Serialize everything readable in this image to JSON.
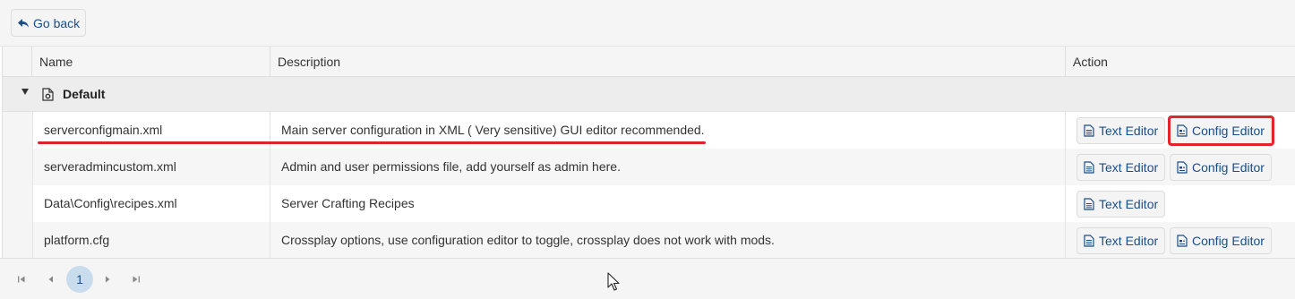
{
  "toolbar": {
    "go_back_label": "Go back"
  },
  "table": {
    "columns": {
      "name": "Name",
      "description": "Description",
      "action": "Action"
    },
    "group": {
      "label": "Default"
    },
    "rows": [
      {
        "name": "serverconfigmain.xml",
        "description": "Main server configuration in XML ( Very sensitive) GUI editor recommended.",
        "text_editor": "Text Editor",
        "config_editor": "Config Editor"
      },
      {
        "name": "serveradmincustom.xml",
        "description": "Admin and user permissions file, add yourself as admin here.",
        "text_editor": "Text Editor",
        "config_editor": "Config Editor"
      },
      {
        "name": "Data\\Config\\recipes.xml",
        "description": "Server Crafting Recipes",
        "text_editor": "Text Editor"
      },
      {
        "name": "platform.cfg",
        "description": "Crossplay options, use configuration editor to toggle, crossplay does not work with mods.",
        "text_editor": "Text Editor",
        "config_editor": "Config Editor"
      }
    ]
  },
  "pager": {
    "current_page": "1"
  },
  "colors": {
    "accent": "#1a4e8a",
    "highlight": "#e0262b",
    "active_page_bg": "#c9dced"
  },
  "icons": [
    "undo-arrow-icon",
    "collapse-caret-icon",
    "file-gear-icon",
    "file-text-icon",
    "config-file-icon",
    "first-page-icon",
    "prev-page-icon",
    "next-page-icon",
    "last-page-icon",
    "mouse-cursor-icon"
  ]
}
